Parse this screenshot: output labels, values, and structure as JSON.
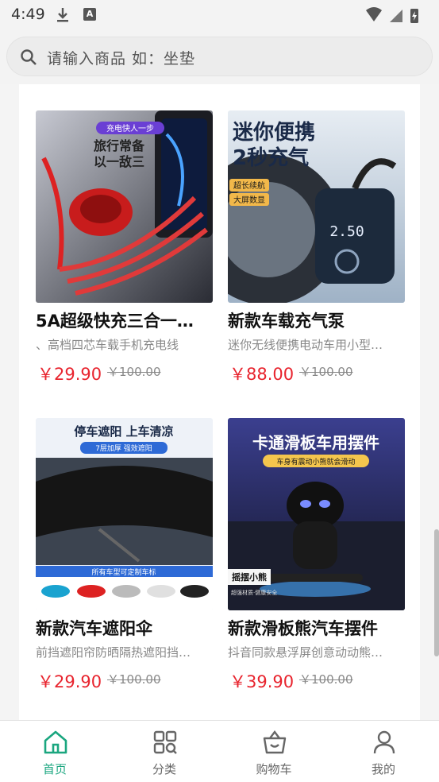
{
  "status_bar": {
    "time": "4:49",
    "icon_letter": "A"
  },
  "search": {
    "placeholder": "请输入商品 如：坐垫"
  },
  "products": [
    {
      "title": "5A超级快充三合一…",
      "subtitle": "、高档四芯车载手机充电线",
      "price": "￥29.90",
      "original_price": "￥100.00",
      "image": {
        "badge": "充电快人一步",
        "lines": [
          "旅行常备",
          "以一敌三"
        ],
        "colors": [
          "#2a2a2a",
          "#e03a3a"
        ]
      }
    },
    {
      "title": "新款车载充气泵",
      "subtitle": "迷你无线便携电动车用小型…",
      "price": "￥88.00",
      "original_price": "￥100.00",
      "image": {
        "lines": [
          "迷你便携",
          "2秒充气"
        ],
        "tags": [
          "超长续航",
          "大屏数显"
        ],
        "display": "2.50",
        "colors": [
          "#f2b84a",
          "#1c2a3c"
        ]
      }
    },
    {
      "title": "新款汽车遮阳伞",
      "subtitle": "前挡遮阳帘防晒隔热遮阳挡…",
      "price": "￥29.90",
      "original_price": "￥100.00",
      "image": {
        "headline": "停车遮阳 上车清凉",
        "badge": "7层加厚 强效遮阳",
        "footer": "所有车型可定制车标",
        "colors": [
          "#2e6ad6",
          "#1a1a1a"
        ]
      }
    },
    {
      "title": "新款滑板熊汽车摆件",
      "subtitle": "抖音同款悬浮屏创意动动熊…",
      "price": "￥39.90",
      "original_price": "￥100.00",
      "image": {
        "headline": "卡通滑板车用摆件",
        "badge": "车身有震动小熊就会滑动",
        "tag": "摇摆小熊",
        "tag2": "超强材质·健康安全",
        "colors": [
          "#3b3f8f",
          "#111"
        ]
      }
    }
  ],
  "tabs": [
    {
      "label": "首页",
      "icon": "home-icon",
      "active": true
    },
    {
      "label": "分类",
      "icon": "category-icon",
      "active": false
    },
    {
      "label": "购物车",
      "icon": "cart-icon",
      "active": false
    },
    {
      "label": "我的",
      "icon": "profile-icon",
      "active": false
    }
  ],
  "colors": {
    "accent": "#1aa67f",
    "price": "#e8242e"
  }
}
